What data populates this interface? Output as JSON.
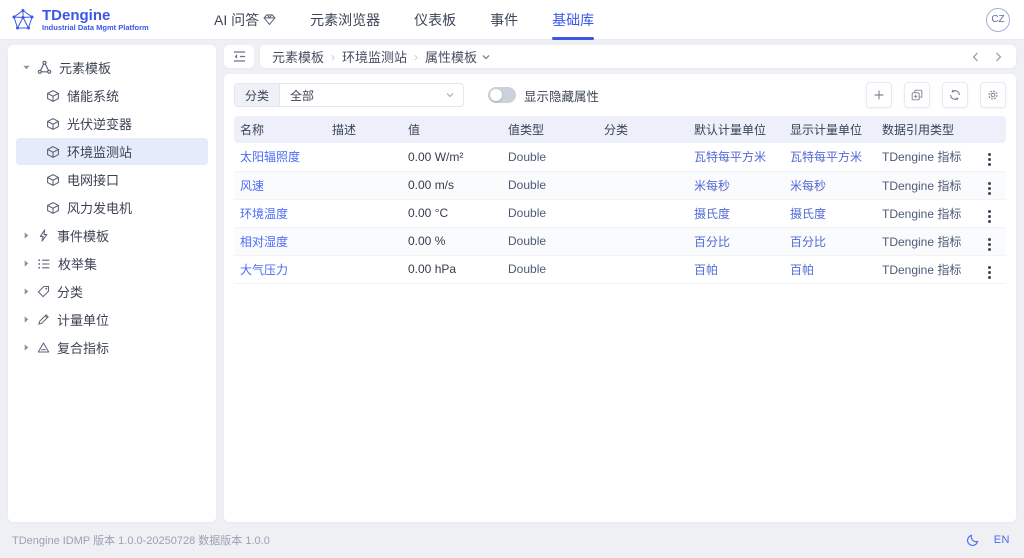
{
  "header": {
    "brand": {
      "name": "TDengine",
      "subtitle": "Industrial Data Mgmt Platform"
    },
    "nav": [
      {
        "key": "ai-qa",
        "label": "AI 问答",
        "icon": "gem-icon",
        "active": false
      },
      {
        "key": "element-browser",
        "label": "元素浏览器",
        "active": false
      },
      {
        "key": "dashboard",
        "label": "仪表板",
        "active": false
      },
      {
        "key": "events",
        "label": "事件",
        "active": false
      },
      {
        "key": "base-library",
        "label": "基础库",
        "active": true
      }
    ],
    "avatar_initials": "CZ"
  },
  "sidebar": {
    "items": [
      {
        "key": "element-templates",
        "label": "元素模板",
        "icon": "molecule-icon",
        "level": 0,
        "caret": "down",
        "selected": false
      },
      {
        "key": "storage-system",
        "label": "储能系统",
        "icon": "cube-icon",
        "level": 1,
        "selected": false
      },
      {
        "key": "pv-inverter",
        "label": "光伏逆变器",
        "icon": "cube-icon",
        "level": 1,
        "selected": false
      },
      {
        "key": "env-station",
        "label": "环境监测站",
        "icon": "cube-icon",
        "level": 1,
        "selected": true
      },
      {
        "key": "grid-interface",
        "label": "电网接口",
        "icon": "cube-icon",
        "level": 1,
        "selected": false
      },
      {
        "key": "wind-turbine",
        "label": "风力发电机",
        "icon": "cube-icon",
        "level": 1,
        "selected": false
      },
      {
        "key": "event-templates",
        "label": "事件模板",
        "icon": "bolt-icon",
        "level": 0,
        "caret": "right",
        "selected": false
      },
      {
        "key": "enum-sets",
        "label": "枚举集",
        "icon": "list-icon",
        "level": 0,
        "caret": "right",
        "selected": false
      },
      {
        "key": "categories",
        "label": "分类",
        "icon": "tag-icon",
        "level": 0,
        "caret": "right",
        "selected": false
      },
      {
        "key": "measure-units",
        "label": "计量单位",
        "icon": "pen-icon",
        "level": 0,
        "caret": "right",
        "selected": false
      },
      {
        "key": "composite-metrics",
        "label": "复合指标",
        "icon": "triangle-icon",
        "level": 0,
        "caret": "right",
        "selected": false
      }
    ]
  },
  "breadcrumb": {
    "items": [
      "元素模板",
      "环境监测站",
      "属性模板"
    ]
  },
  "toolbar": {
    "category_label": "分类",
    "category_value": "全部",
    "toggle_label": "显示隐藏属性",
    "toggle_on": false,
    "buttons": [
      {
        "key": "add",
        "icon": "plus-icon"
      },
      {
        "key": "batch-add",
        "icon": "copy-plus-icon"
      },
      {
        "key": "refresh",
        "icon": "refresh-icon"
      },
      {
        "key": "settings",
        "icon": "gear-icon"
      }
    ]
  },
  "table": {
    "columns": [
      "名称",
      "描述",
      "值",
      "值类型",
      "分类",
      "默认计量单位",
      "显示计量单位",
      "数据引用类型"
    ],
    "rows": [
      {
        "name": "太阳辐照度",
        "desc": "",
        "value": "0.00 W/m²",
        "value_type": "Double",
        "category": "",
        "default_unit": "瓦特每平方米",
        "display_unit": "瓦特每平方米",
        "data_ref_type": "TDengine 指标"
      },
      {
        "name": "风速",
        "desc": "",
        "value": "0.00 m/s",
        "value_type": "Double",
        "category": "",
        "default_unit": "米每秒",
        "display_unit": "米每秒",
        "data_ref_type": "TDengine 指标"
      },
      {
        "name": "环境温度",
        "desc": "",
        "value": "0.00 °C",
        "value_type": "Double",
        "category": "",
        "default_unit": "摄氏度",
        "display_unit": "摄氏度",
        "data_ref_type": "TDengine 指标"
      },
      {
        "name": "相对湿度",
        "desc": "",
        "value": "0.00 %",
        "value_type": "Double",
        "category": "",
        "default_unit": "百分比",
        "display_unit": "百分比",
        "data_ref_type": "TDengine 指标"
      },
      {
        "name": "大气压力",
        "desc": "",
        "value": "0.00 hPa",
        "value_type": "Double",
        "category": "",
        "default_unit": "百帕",
        "display_unit": "百帕",
        "data_ref_type": "TDengine 指标"
      }
    ]
  },
  "footer": {
    "version": "TDengine IDMP 版本 1.0.0-20250728 数据版本 1.0.0",
    "lang": "EN"
  },
  "colors": {
    "primary": "#3a57e8",
    "link": "#4b6bf5",
    "unit_text": "#5269d4",
    "slate_text": "#4e5a78",
    "text_dark": "#353c4e",
    "table_header_bg": "#edf0fb",
    "selected_bg": "#e4ecfb",
    "page_bg": "#eef0f4",
    "footer_text": "#9aa2b3"
  }
}
